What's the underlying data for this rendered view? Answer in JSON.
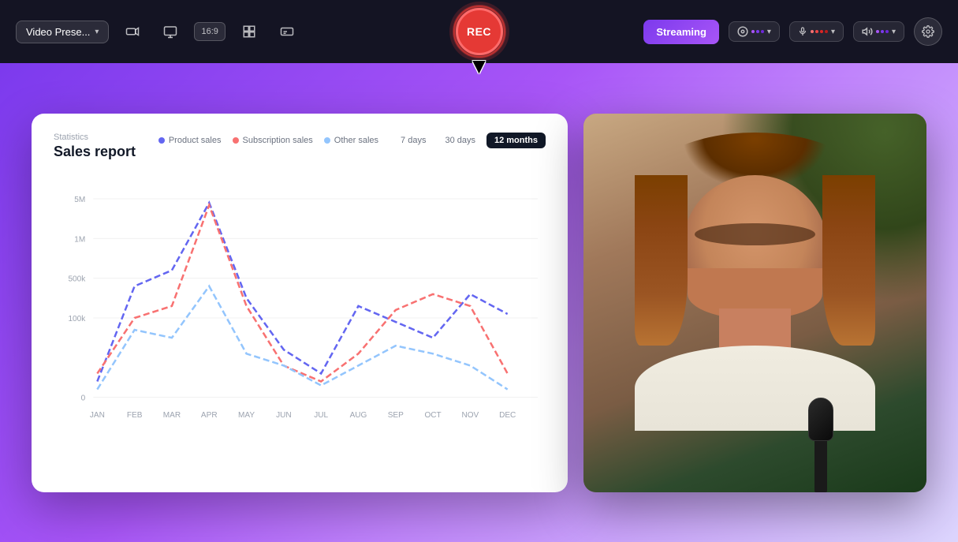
{
  "toolbar": {
    "preset_label": "Video Prese...",
    "rec_label": "REC",
    "streaming_label": "Streaming",
    "ratio_label": "16:9",
    "settings_icon": "⚙",
    "chevron_icon": "▾",
    "camera_icon": "⬜",
    "screen_icon": "▣",
    "layout_icon": "⊞",
    "caption_icon": "⊡"
  },
  "chart": {
    "subtitle": "Statistics",
    "title": "Sales report",
    "legend": {
      "product": "Product sales",
      "subscription": "Subscription sales",
      "other": "Other sales"
    },
    "time_filters": [
      "7 days",
      "30 days",
      "12 months"
    ],
    "active_filter": "12 months",
    "y_labels": [
      "5M",
      "1M",
      "500k",
      "100k",
      "0"
    ],
    "x_labels": [
      "JAN",
      "FEB",
      "MAR",
      "APR",
      "MAY",
      "JUN",
      "JUL",
      "AUG",
      "SEP",
      "OCT",
      "NOV",
      "DEC"
    ]
  }
}
